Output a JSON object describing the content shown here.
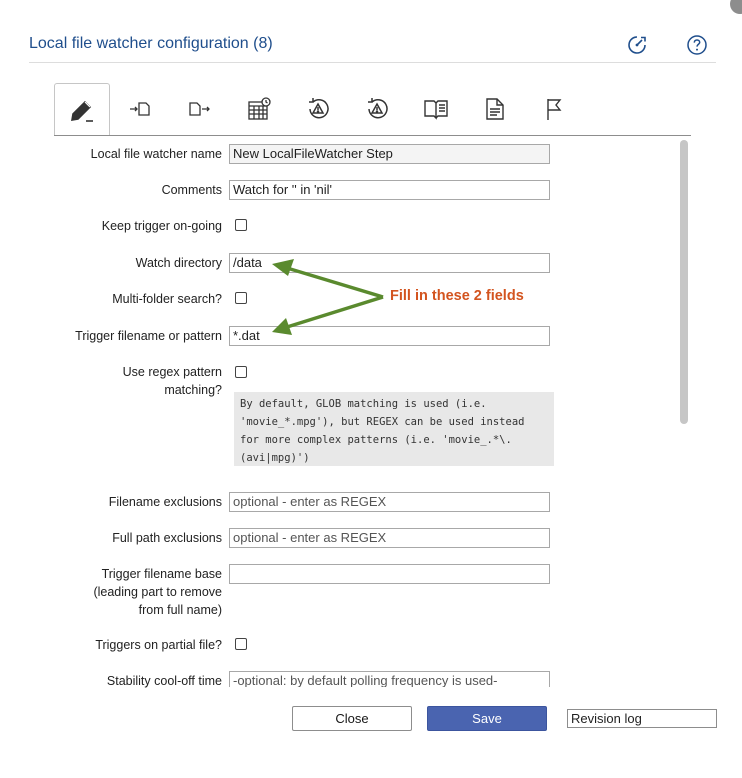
{
  "header": {
    "title": "Local file watcher configuration (8)",
    "icons": [
      "dashboard-icon",
      "help-icon"
    ]
  },
  "tabs": [
    {
      "icon": "pencil-icon",
      "active": true
    },
    {
      "icon": "input-arrow-icon",
      "active": false
    },
    {
      "icon": "output-arrow-icon",
      "active": false
    },
    {
      "icon": "calendar-schedule-icon",
      "active": false
    },
    {
      "icon": "history-warning-icon",
      "active": false
    },
    {
      "icon": "history-warning-alt-icon",
      "active": false
    },
    {
      "icon": "book-icon",
      "active": false
    },
    {
      "icon": "document-icon",
      "active": false
    },
    {
      "icon": "flag-icon",
      "active": false
    }
  ],
  "form": {
    "name_label": "Local file watcher name",
    "name_value": "New LocalFileWatcher Step",
    "comments_label": "Comments",
    "comments_value": "Watch for '' in 'nil'",
    "keep_trigger_label": "Keep trigger on-going",
    "keep_trigger_checked": false,
    "watch_dir_label": "Watch directory",
    "watch_dir_value": "/data",
    "multi_folder_label": "Multi-folder search?",
    "multi_folder_checked": false,
    "trigger_pattern_label": "Trigger filename or pattern",
    "trigger_pattern_value": "*.dat",
    "regex_label_1": "Use regex pattern",
    "regex_label_2": "matching?",
    "regex_checked": false,
    "regex_help": [
      "By default, GLOB matching is used (i.e.",
      "'movie_*.mpg'), but REGEX can be used instead",
      "for more complex patterns (i.e. 'movie_.*\\.",
      "(avi|mpg)')"
    ],
    "filename_excl_label": "Filename exclusions",
    "filename_excl_placeholder": "optional - enter as REGEX",
    "fullpath_excl_label": "Full path exclusions",
    "fullpath_excl_placeholder": "optional - enter as REGEX",
    "trigger_base_label_1": "Trigger filename base",
    "trigger_base_label_2": "(leading part to remove",
    "trigger_base_label_3": "from full name)",
    "trigger_base_value": "",
    "partial_label": "Triggers on partial file?",
    "partial_checked": false,
    "stability_label": "Stability cool-off time",
    "stability_placeholder": "-optional: by default polling frequency is used-"
  },
  "annotation": {
    "text": "Fill in these 2 fields",
    "color": "#d3541f",
    "arrow_color": "#5a8a2e"
  },
  "footer": {
    "close_label": "Close",
    "save_label": "Save",
    "revision_label": "Revision log"
  },
  "colors": {
    "title": "#1f4e8c",
    "save_button": "#4a64b0"
  }
}
